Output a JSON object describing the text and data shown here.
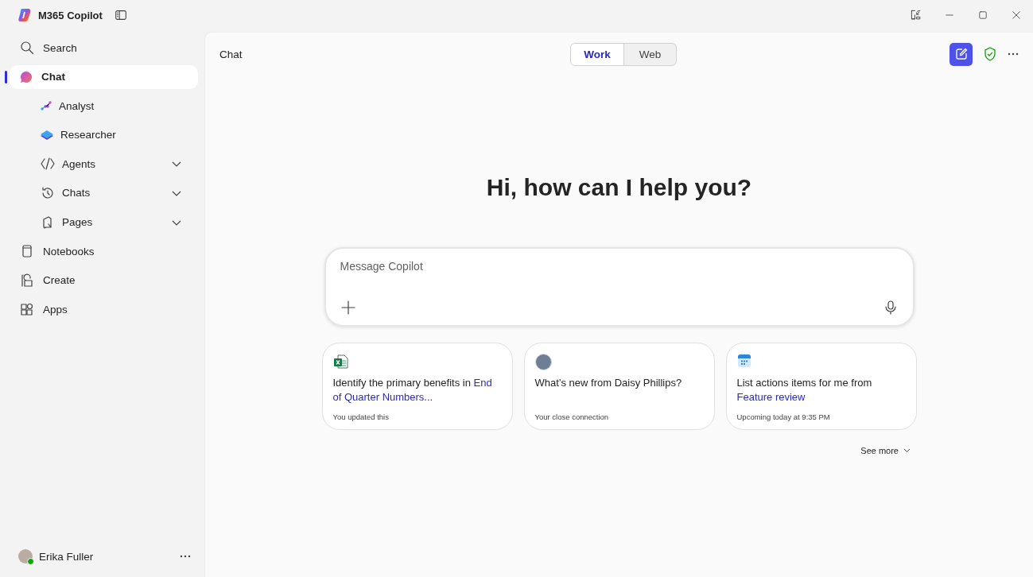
{
  "app": {
    "title": "M365 Copilot"
  },
  "sidebar": {
    "items": [
      {
        "label": "Search",
        "selected": false
      },
      {
        "label": "Chat",
        "selected": true,
        "children": [
          {
            "label": "Analyst",
            "selected": false
          },
          {
            "label": "Researcher",
            "selected": false
          },
          {
            "label": "Agents",
            "selected": false,
            "expanded": false
          },
          {
            "label": "Chats",
            "selected": false,
            "expanded": false
          },
          {
            "label": "Pages",
            "selected": false,
            "expanded": false
          }
        ]
      },
      {
        "label": "Notebooks",
        "selected": false
      },
      {
        "label": "Create",
        "selected": false
      },
      {
        "label": "Apps",
        "selected": false
      }
    ],
    "user": {
      "name": "Erika Fuller"
    }
  },
  "header": {
    "title": "Chat",
    "tabs": [
      {
        "label": "Work",
        "selected": true
      },
      {
        "label": "Web",
        "selected": false
      }
    ]
  },
  "greeting": "Hi, how can I help you?",
  "composer": {
    "placeholder": "Message Copilot"
  },
  "suggestions": [
    {
      "kind": "spreadsheet",
      "text": "Identify the primary benefits in ",
      "link": "End of Quarter Numbers...",
      "caption": "You updated this"
    },
    {
      "kind": "person",
      "text": "What’s new from Daisy Phillips?",
      "caption": "Your close connection"
    },
    {
      "kind": "calendar",
      "text": "List actions items for me from ",
      "link": "Feature review",
      "caption": "Upcoming today at 9:35 PM"
    }
  ],
  "see_more": "See more"
}
